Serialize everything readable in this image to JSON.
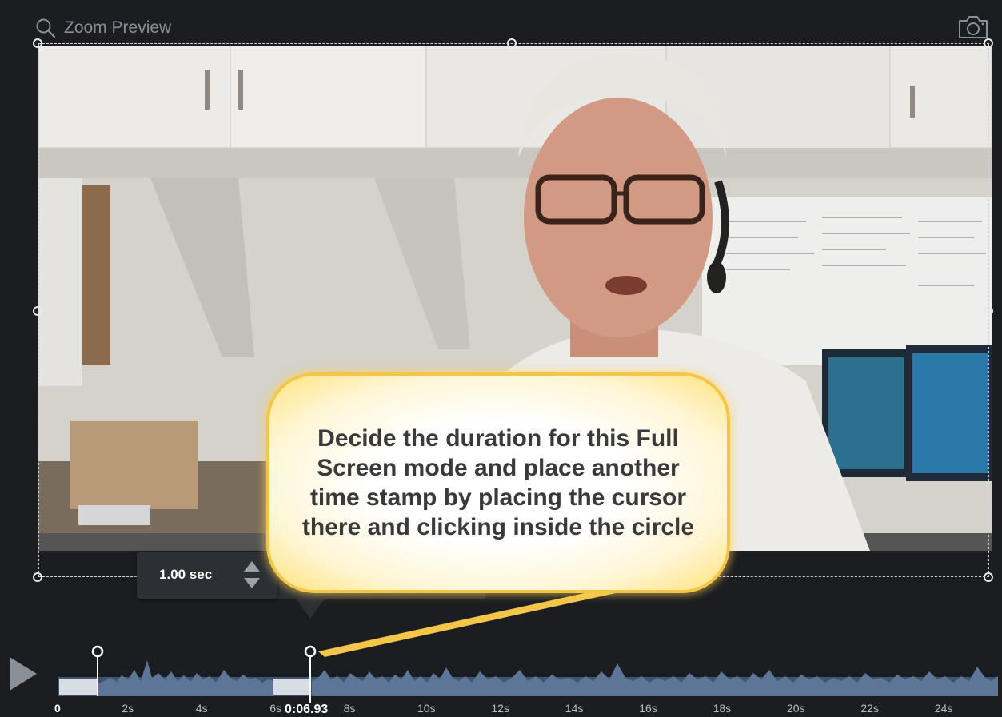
{
  "header": {
    "title": "Zoom Preview",
    "icons": {
      "search": "search-icon",
      "snapshot": "camera-icon"
    }
  },
  "duration_popup": {
    "value": "1.00 sec"
  },
  "callout": {
    "text": "Decide the duration for this Full Screen mode and place another time stamp by placing the cursor there and clicking inside the circle"
  },
  "timeline": {
    "tick_labels": [
      "0",
      "2s",
      "4s",
      "6s",
      "8s",
      "10s",
      "12s",
      "14s",
      "16s",
      "18s",
      "20s",
      "22s",
      "24s"
    ],
    "current_time": "0:06.93",
    "markers_seconds": [
      1.1,
      6.9
    ]
  },
  "colors": {
    "background": "#1b1d20",
    "waveform": "#5d7698",
    "track": "#3f5572",
    "selection": "#d8dde4",
    "callout_border": "#f3c64a"
  }
}
